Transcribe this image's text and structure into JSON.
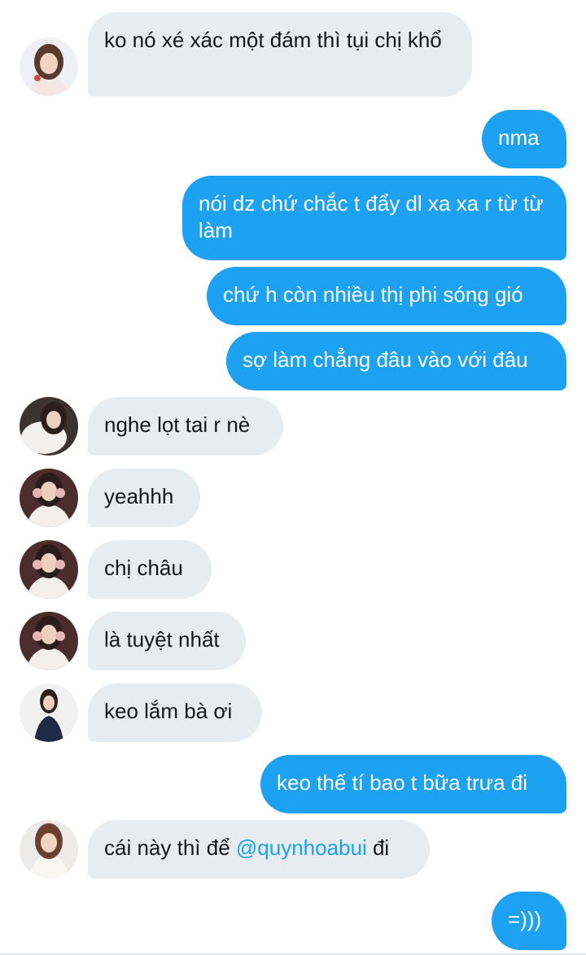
{
  "conversation": {
    "messages": [
      {
        "direction": "incoming",
        "text": "ko nó xé xác một đám thì tụi chị khổ"
      },
      {
        "direction": "outgoing",
        "text": "nma"
      },
      {
        "direction": "outgoing",
        "text": "nói dz chứ chắc t đẩy dl xa xa r từ từ làm"
      },
      {
        "direction": "outgoing",
        "text": "chứ h còn nhiều thị phi sóng gió"
      },
      {
        "direction": "outgoing",
        "text": "sợ làm chẳng đâu vào với đâu"
      },
      {
        "direction": "incoming",
        "text": "nghe lọt tai r nè"
      },
      {
        "direction": "incoming",
        "text": "yeahhh"
      },
      {
        "direction": "incoming",
        "text": "chị châu"
      },
      {
        "direction": "incoming",
        "text": "là tuyệt nhất"
      },
      {
        "direction": "incoming",
        "text": "keo lắm bà ơi"
      },
      {
        "direction": "outgoing",
        "text": "keo thế tí bao t bữa trưa đi"
      },
      {
        "direction": "incoming",
        "text_before": "cái này thì để ",
        "mention": "@quynhoabui",
        "text_after": " đi"
      },
      {
        "direction": "outgoing",
        "text": "=)))"
      }
    ]
  },
  "colors": {
    "incoming_bubble": "#e6ecf0",
    "outgoing_bubble": "#1da1f2",
    "mention": "#1da1f2"
  }
}
